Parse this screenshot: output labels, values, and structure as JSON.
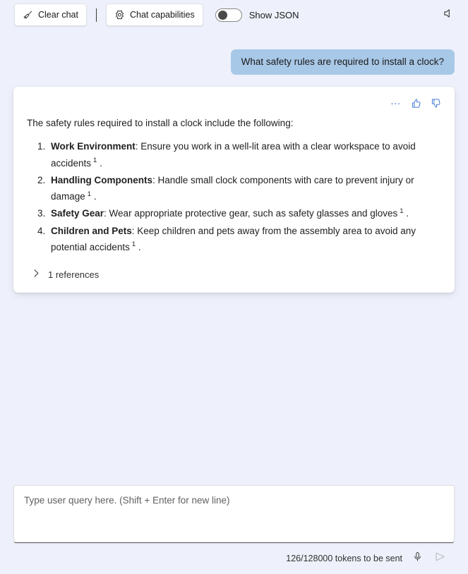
{
  "toolbar": {
    "clear_chat_label": "Clear chat",
    "clear_chat_icon": "broom-icon",
    "chat_capabilities_label": "Chat capabilities",
    "chat_capabilities_icon": "gear-icon",
    "show_json_label": "Show JSON",
    "show_json_state": "off",
    "speaker_icon": "speaker-icon"
  },
  "conversation": {
    "user_message": "What safety rules are required to install a clock?",
    "assistant": {
      "actions": {
        "more_label": "…",
        "more_icon": "ellipsis-icon",
        "thumbs_up_icon": "thumbs-up-icon",
        "thumbs_down_icon": "thumbs-down-icon"
      },
      "intro": "The safety rules required to install a clock include the following:",
      "items": [
        {
          "title": "Work Environment",
          "text": ": Ensure you work in a well-lit area with a clear workspace to avoid accidents",
          "citation": "1",
          "tail": "."
        },
        {
          "title": "Handling Components",
          "text": ": Handle small clock components with care to prevent injury or damage",
          "citation": "1",
          "tail": "."
        },
        {
          "title": "Safety Gear",
          "text": ": Wear appropriate protective gear, such as safety glasses and gloves",
          "citation": "1",
          "tail": "."
        },
        {
          "title": "Children and Pets",
          "text": ": Keep children and pets away from the assembly area to avoid any potential accidents",
          "citation": "1",
          "tail": "."
        }
      ],
      "references_label": "1 references",
      "references_icon": "chevron-right-icon",
      "references_expanded": "false"
    }
  },
  "composer": {
    "placeholder": "Type user query here. (Shift + Enter for new line)",
    "value": "",
    "token_status": "126/128000 tokens to be sent",
    "mic_icon": "microphone-icon",
    "send_icon": "send-icon"
  },
  "colors": {
    "page_background": "#eef1fb",
    "card_background": "#ffffff",
    "user_bubble": "#a8c8e8",
    "action_accent": "#4a7fd4",
    "text_primary": "#201f1e",
    "text_secondary": "#616161"
  }
}
